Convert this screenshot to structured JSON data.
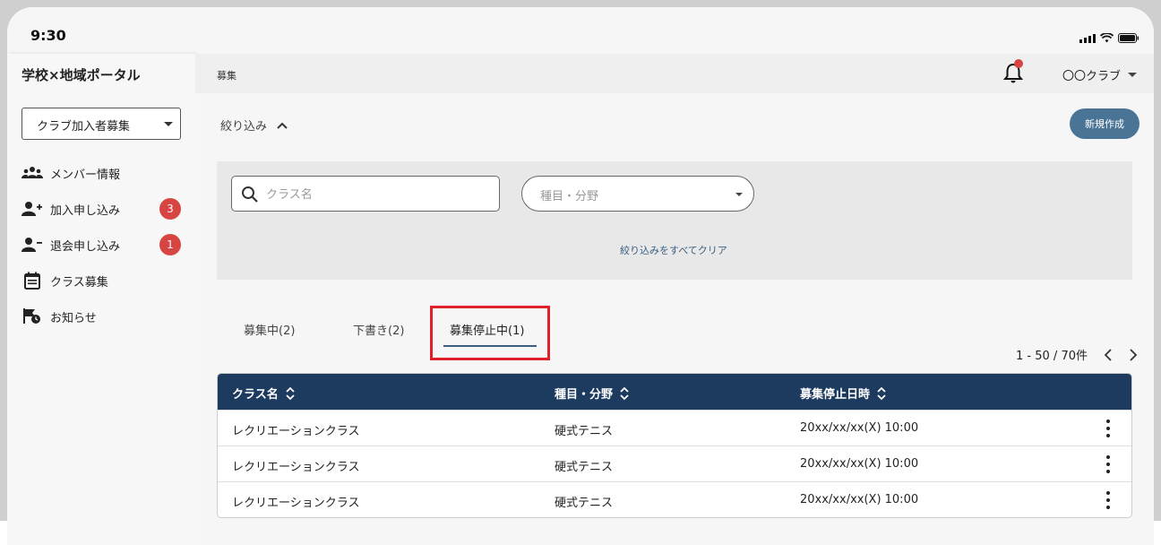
{
  "status_bar": {
    "time": "9:30"
  },
  "sidebar": {
    "app_title": "学校×地域ポータル",
    "club_select": "クラブ加入者募集",
    "items": [
      {
        "label": "メンバー情報",
        "icon": "people-group-icon"
      },
      {
        "label": "加入申し込み",
        "icon": "person-add-icon",
        "badge": "3"
      },
      {
        "label": "退会申し込み",
        "icon": "person-remove-icon",
        "badge": "1"
      },
      {
        "label": "クラス募集",
        "icon": "calendar-list-icon"
      },
      {
        "label": "お知らせ",
        "icon": "flag-clock-icon"
      }
    ]
  },
  "header": {
    "breadcrumb": "募集",
    "user": "〇〇クラブ"
  },
  "main": {
    "filter_toggle": "絞り込み",
    "new_button": "新規作成",
    "search": {
      "placeholder": "クラス名",
      "value": ""
    },
    "category_select": "種目・分野",
    "clear_link": "絞り込みをすべてクリア",
    "tabs": [
      {
        "label": "募集中(2)"
      },
      {
        "label": "下書き(2)"
      },
      {
        "label": "募集停止中(1)",
        "active": true
      }
    ],
    "pagination": "1 - 50 / 70件",
    "table": {
      "columns": [
        "クラス名",
        "種目・分野",
        "募集停止日時"
      ],
      "rows": [
        [
          "レクリエーションクラス",
          "硬式テニス",
          "20xx/xx/xx(X) 10:00"
        ],
        [
          "レクリエーションクラス",
          "硬式テニス",
          "20xx/xx/xx(X) 10:00"
        ],
        [
          "レクリエーションクラス",
          "硬式テニス",
          "20xx/xx/xx(X) 10:00"
        ]
      ]
    }
  },
  "colors": {
    "accent": "#1d3a5f",
    "button": "#4a7496",
    "badge": "#d64541",
    "highlight": "#e0202a"
  }
}
